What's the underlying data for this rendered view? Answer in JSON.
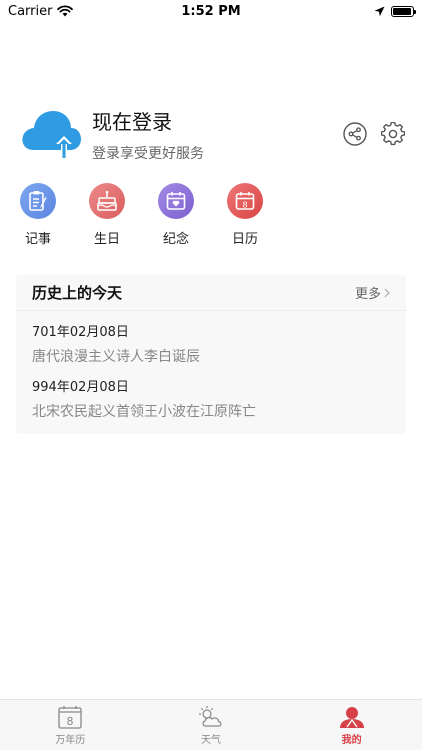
{
  "status_bar": {
    "carrier": "Carrier",
    "time": "1:52 PM",
    "battery_percent": 95
  },
  "profile": {
    "title": "现在登录",
    "subtitle": "登录享受更好服务",
    "avatar_icon": "cloud-upload-icon",
    "share_icon": "share-icon",
    "settings_icon": "gear-icon"
  },
  "quick_actions": [
    {
      "label": "记事",
      "icon": "notebook-icon",
      "color": "#6a93e8"
    },
    {
      "label": "生日",
      "icon": "birthday-cake-icon",
      "color": "#e06c6c"
    },
    {
      "label": "纪念",
      "icon": "heart-calendar-icon",
      "color": "#8c6fd6"
    },
    {
      "label": "日历",
      "icon": "calendar-icon",
      "color": "#e05a5a"
    }
  ],
  "history": {
    "title": "历史上的今天",
    "more": "更多",
    "items": [
      {
        "date": "701年02月08日",
        "event": "唐代浪漫主义诗人李白诞辰"
      },
      {
        "date": "994年02月08日",
        "event": "北宋农民起义首领王小波在江原阵亡"
      }
    ]
  },
  "calendar_day": "8",
  "tabs": [
    {
      "label": "万年历",
      "icon": "calendar-tab-icon",
      "active": false
    },
    {
      "label": "天气",
      "icon": "weather-tab-icon",
      "active": false
    },
    {
      "label": "我的",
      "icon": "profile-tab-icon",
      "active": true
    }
  ],
  "colors": {
    "accent": "#d64047",
    "cloud_blue": "#2f9be3"
  }
}
